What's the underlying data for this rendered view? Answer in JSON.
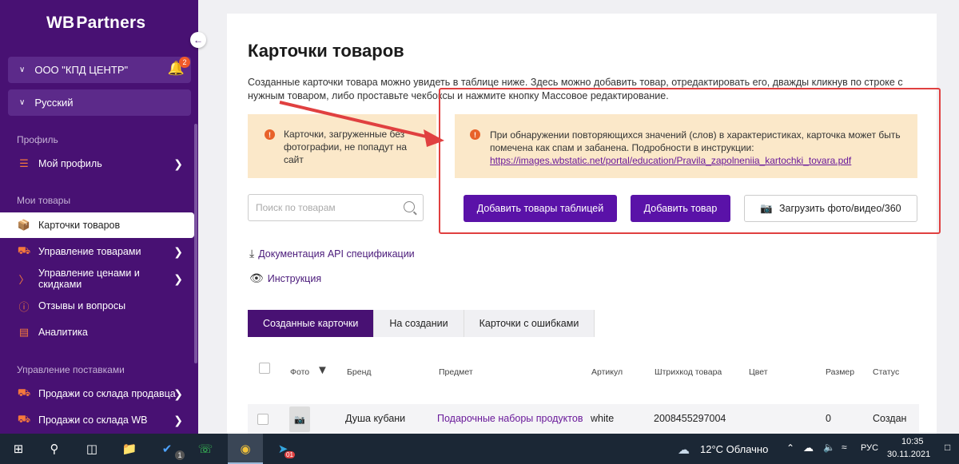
{
  "sidebar": {
    "logo_main": "WB",
    "logo_sup": "",
    "logo_rest": "Partners",
    "org_name": "ООО \"КПД ЦЕНТР\"",
    "notifications_count": "2",
    "language": "Русский",
    "section_profile": "Профиль",
    "my_profile": "Мой профиль",
    "section_goods": "Мои товары",
    "items": [
      {
        "label": "Карточки товаров"
      },
      {
        "label": "Управление товарами"
      },
      {
        "label": "Управление ценами и скидками"
      },
      {
        "label": "Отзывы и вопросы"
      },
      {
        "label": "Аналитика"
      }
    ],
    "section_supply": "Управление поставками",
    "supply_items": [
      {
        "label": "Продажи со склада продавца"
      },
      {
        "label": "Продажи со склада WB"
      }
    ]
  },
  "main": {
    "title": "Карточки товаров",
    "description": "Созданные карточки товара можно увидеть в таблице ниже. Здесь можно добавить товар, отредактировать его, дважды кликнув по строке с нужным товаром, либо проставьте чекбоксы и нажмите кнопку Массовое редактирование.",
    "warning_left": "Карточки, загруженные без фотографии, не попадут на сайт",
    "warning_right": "При обнаружении повторяющихся значений (слов) в характеристиках, карточка может быть помечена как спам и забанена. Подробности в инструкции:",
    "warning_link": "https://images.wbstatic.net/portal/education/Pravila_zapolneniia_kartochki_tovara.pdf",
    "search_placeholder": "Поиск по товарам",
    "btn_add_table": "Добавить товары таблицей",
    "btn_add_product": "Добавить товар",
    "btn_upload": "Загрузить фото/видео/360",
    "link_api": "Документация API спецификации",
    "link_instruction": "Инструкция",
    "tabs": [
      {
        "label": "Созданные карточки"
      },
      {
        "label": "На создании"
      },
      {
        "label": "Карточки с ошибками"
      }
    ],
    "columns": {
      "photo": "Фото",
      "brand": "Бренд",
      "subject": "Предмет",
      "article": "Артикул",
      "barcode": "Штрихкод товара",
      "color": "Цвет",
      "size": "Размер",
      "status": "Статус"
    },
    "rows": [
      {
        "brand": "Душа кубани",
        "subject": "Подарочные наборы продуктов",
        "article": "white",
        "barcode": "2008455297004",
        "color": "",
        "size": "0",
        "status": "Создан"
      }
    ]
  },
  "taskbar": {
    "weather": "12°C Облачно",
    "language": "РУС",
    "time": "10:35",
    "date": "30.11.2021",
    "todo_badge": "1",
    "telegram_badge": "01"
  },
  "colors": {
    "sidebar_bg": "#481173",
    "primary_button": "#5a12a8",
    "warning_bg": "#fbe8c9",
    "annotation_red": "#e04040"
  }
}
